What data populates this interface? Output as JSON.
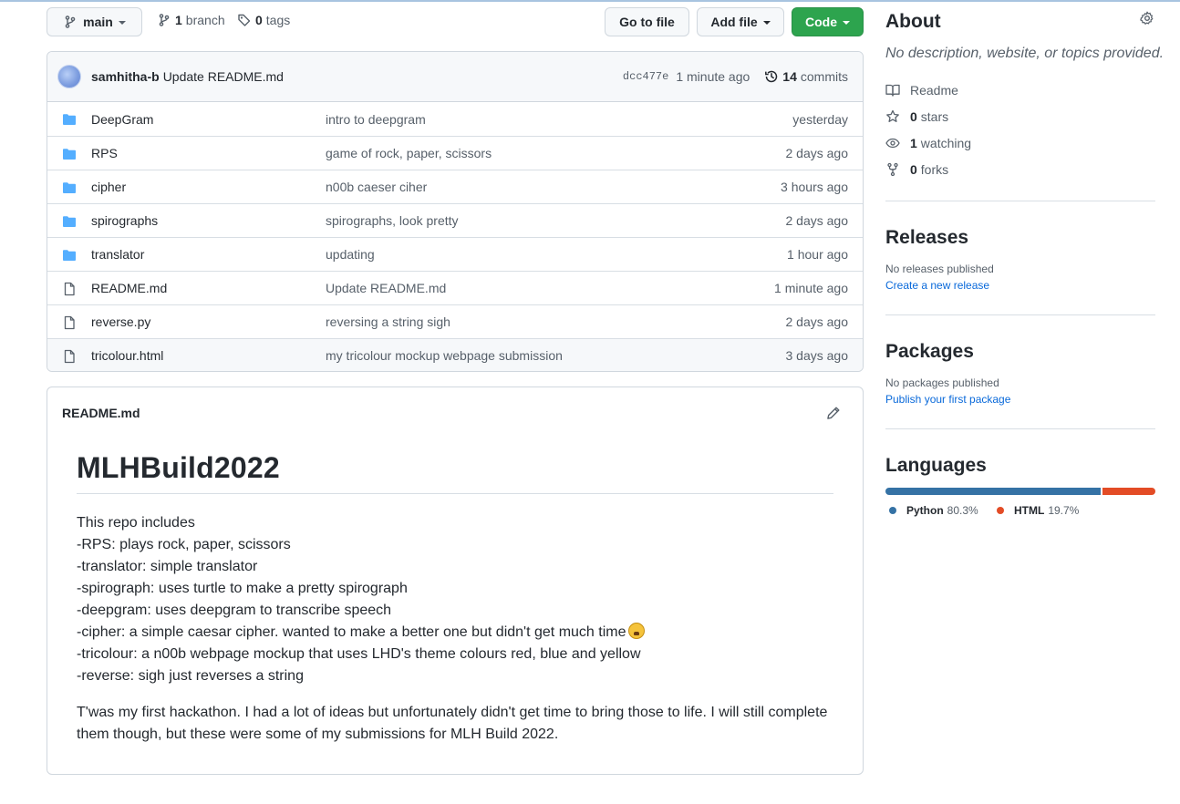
{
  "toolbar": {
    "branch_name": "main",
    "branches_count": "1",
    "branches_label": "branch",
    "tags_count": "0",
    "tags_label": "tags",
    "go_to_file": "Go to file",
    "add_file": "Add file",
    "code": "Code"
  },
  "commit": {
    "author": "samhitha-b",
    "message": "Update README.md",
    "sha": "dcc477e",
    "time": "1 minute ago",
    "commits_count": "14",
    "commits_label": "commits"
  },
  "files": [
    {
      "name": "DeepGram",
      "type": "folder",
      "message": "intro to deepgram",
      "age": "yesterday"
    },
    {
      "name": "RPS",
      "type": "folder",
      "message": "game of rock, paper, scissors",
      "age": "2 days ago"
    },
    {
      "name": "cipher",
      "type": "folder",
      "message": "n00b caeser ciher",
      "age": "3 hours ago"
    },
    {
      "name": "spirographs",
      "type": "folder",
      "message": "spirographs, look pretty",
      "age": "2 days ago"
    },
    {
      "name": "translator",
      "type": "folder",
      "message": "updating",
      "age": "1 hour ago"
    },
    {
      "name": "README.md",
      "type": "file",
      "message": "Update README.md",
      "age": "1 minute ago"
    },
    {
      "name": "reverse.py",
      "type": "file",
      "message": "reversing a string sigh",
      "age": "2 days ago"
    },
    {
      "name": "tricolour.html",
      "type": "file",
      "message": "my tricolour mockup webpage submission",
      "age": "3 days ago"
    }
  ],
  "readme": {
    "filename": "README.md",
    "title": "MLHBuild2022",
    "lines": [
      "This repo includes",
      "-RPS: plays rock, paper, scissors",
      "-translator: simple translator",
      "-spirograph: uses turtle to make a pretty spirograph",
      "-deepgram: uses deepgram to transcribe speech",
      "-cipher: a simple caesar cipher. wanted to make a better one but didn't get much time",
      "-tricolour: a n00b webpage mockup that uses LHD's theme colours red, blue and yellow",
      "-reverse: sigh just reverses a string"
    ],
    "paragraph": "T'was my first hackathon. I had a lot of ideas but unfortunately didn't get time to bring those to life. I will still complete them though, but these were some of my submissions for MLH Build 2022.",
    "emoji_icon": "weary-face-emoji"
  },
  "about": {
    "title": "About",
    "description": "No description, website, or topics provided.",
    "readme_label": "Readme",
    "stars_count": "0",
    "stars_label": "stars",
    "watching_count": "1",
    "watching_label": "watching",
    "forks_count": "0",
    "forks_label": "forks"
  },
  "releases": {
    "title": "Releases",
    "empty_text": "No releases published",
    "link": "Create a new release"
  },
  "packages": {
    "title": "Packages",
    "empty_text": "No packages published",
    "link": "Publish your first package"
  },
  "languages": {
    "title": "Languages",
    "items": [
      {
        "name": "Python",
        "percent": "80.3%",
        "value": 80.3,
        "color": "#3572A5"
      },
      {
        "name": "HTML",
        "percent": "19.7%",
        "value": 19.7,
        "color": "#e34c26"
      }
    ]
  },
  "colors": {
    "accent_green": "#2da44e",
    "link_blue": "#0969da",
    "folder_blue": "#54aeff"
  }
}
